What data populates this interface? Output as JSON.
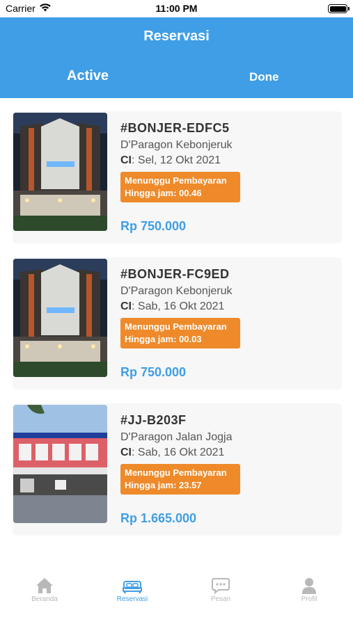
{
  "status_bar": {
    "carrier": "Carrier",
    "time": "11:00 PM"
  },
  "header": {
    "title": "Reservasi",
    "tabs": [
      {
        "label": "Active",
        "selected": true
      },
      {
        "label": "Done",
        "selected": false
      }
    ]
  },
  "reservations": [
    {
      "code": "#BONJER-EDFC5",
      "hotel": "D'Paragon Kebonjeruk",
      "checkin_label": "CI",
      "checkin_value": ": Sel, 12 Okt 2021",
      "status_line1": "Menunggu Pembayaran",
      "status_line2": "Hingga jam: 00.46",
      "price": "Rp 750.000",
      "image": "hotel-night-facade"
    },
    {
      "code": "#BONJER-FC9ED",
      "hotel": "D'Paragon Kebonjeruk",
      "checkin_label": "CI",
      "checkin_value": ": Sab, 16 Okt 2021",
      "status_line1": "Menunggu Pembayaran",
      "status_line2": "Hingga jam: 00.03",
      "price": "Rp 750.000",
      "image": "hotel-night-facade"
    },
    {
      "code": "#JJ-B203F",
      "hotel": "D'Paragon Jalan Jogja",
      "checkin_label": "CI",
      "checkin_value": ": Sab, 16 Okt 2021",
      "status_line1": "Menunggu Pembayaran",
      "status_line2": "Hingga jam: 23.57",
      "price": "Rp 1.665.000",
      "image": "hotel-day-building"
    }
  ],
  "tabbar": [
    {
      "label": "Beranda",
      "icon": "home-icon",
      "active": false
    },
    {
      "label": "Reservasi",
      "icon": "bed-icon",
      "active": true
    },
    {
      "label": "Pesan",
      "icon": "chat-icon",
      "active": false
    },
    {
      "label": "Profil",
      "icon": "person-icon",
      "active": false
    }
  ],
  "colors": {
    "primary": "#3f9ee6",
    "status_badge": "#ee8a2a",
    "card_bg": "#f7f7f7",
    "inactive_tab": "#b8b8b8"
  }
}
